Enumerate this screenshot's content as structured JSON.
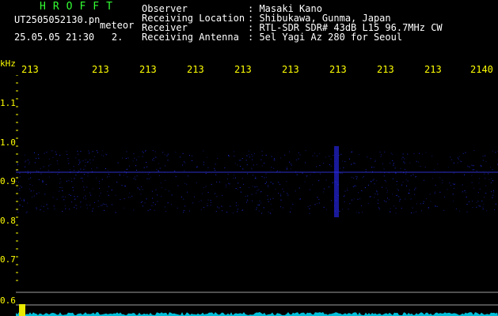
{
  "header": {
    "app_name": "HROFFT",
    "file_name": "UT2505052130.pn",
    "mode_label": "meteor",
    "datetime": "25.05.05 21:30",
    "channel": "2.",
    "info": [
      {
        "label": "Observer",
        "value": ": Masaki Kano"
      },
      {
        "label": "Receiving Location",
        "value": ": Shibukawa, Gunma, Japan"
      },
      {
        "label": "Receiver",
        "value": ": RTL-SDR SDR# 43dB L15 96.7MHz CW"
      },
      {
        "label": "Receiving Antenna",
        "value": ": 5el Yagi Az 280 for Seoul"
      }
    ]
  },
  "axis": {
    "unit_label": "kHz",
    "y_ticks": [
      "1.1",
      "1.0",
      "0.9",
      "0.8",
      "0.7",
      "0.6"
    ],
    "x_ticks": [
      "213",
      "213",
      "213",
      "213",
      "213",
      "213",
      "213",
      "213",
      "213",
      "2140"
    ]
  },
  "colors": {
    "text_white": "#ffffff",
    "app_name": "#33ff33",
    "axis": "#ffff00",
    "grid": "#a0a0a0",
    "signal": "#2233ff",
    "spectrum": "#00e0ff"
  }
}
